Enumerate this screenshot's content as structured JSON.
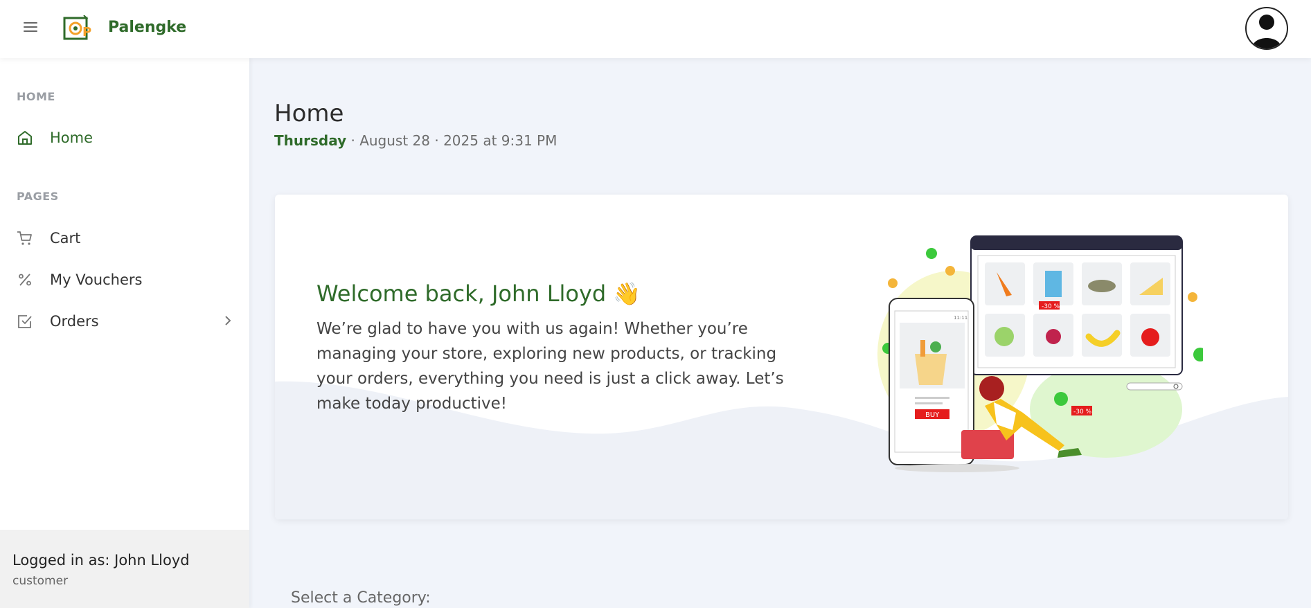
{
  "header": {
    "brand": "Palengke",
    "menu_icon": "hamburger-icon",
    "avatar_icon": "user-avatar-icon"
  },
  "sidebar": {
    "sections": [
      {
        "label": "HOME",
        "items": [
          {
            "label": "Home",
            "icon": "home-icon",
            "active": true
          }
        ]
      },
      {
        "label": "PAGES",
        "items": [
          {
            "label": "Cart",
            "icon": "cart-icon"
          },
          {
            "label": "My Vouchers",
            "icon": "percent-icon"
          },
          {
            "label": "Orders",
            "icon": "checkbox-icon",
            "has_submenu": true
          }
        ]
      }
    ],
    "footer": {
      "user": "Logged in as: John Lloyd",
      "role": "customer"
    }
  },
  "main": {
    "title": "Home",
    "date": {
      "day": "Thursday",
      "rest": " · August 28 · 2025 at 9:31 PM"
    },
    "welcome": {
      "title": "Welcome back, John Lloyd 👋",
      "text": "We’re glad to have you with us again! Whether you’re managing your store, exploring new products, or tracking your orders, everything you need is just a click away. Let’s make today productive!",
      "illustration": {
        "buy_label": "BUY",
        "discount_label": "-30 %",
        "time_label": "11:11"
      }
    },
    "select_category_label": "Select a Category:"
  },
  "colors": {
    "brand_green": "#2f6b2a",
    "background": "#f1f4fa",
    "accent_orange": "#f4a12a"
  }
}
